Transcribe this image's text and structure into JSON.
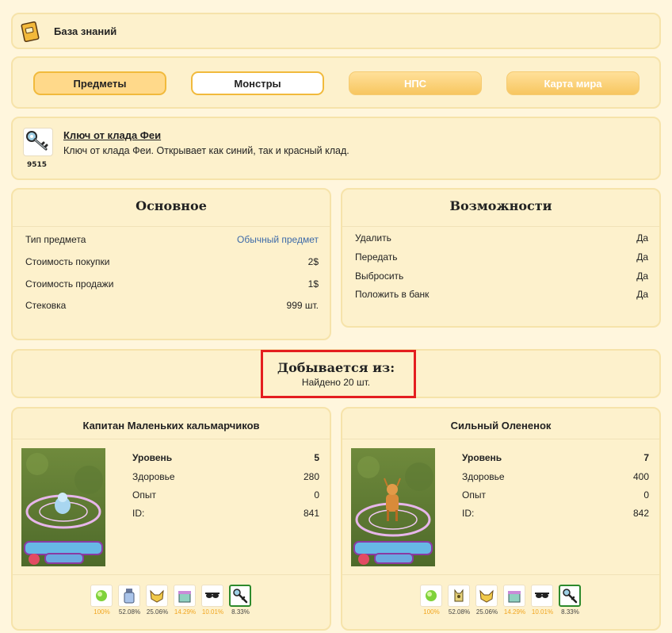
{
  "header": {
    "title": "База знаний",
    "icon": "book-icon"
  },
  "tabs": [
    {
      "label": "Предметы"
    },
    {
      "label": "Монстры"
    },
    {
      "label": "НПС"
    },
    {
      "label": "Карта мира"
    }
  ],
  "item": {
    "icon": "key-icon",
    "id": "9515",
    "name": "Ключ от клада Феи",
    "description": "Ключ от клада Феи. Открывает как синий, так и красный клад."
  },
  "basic": {
    "title": "Основное",
    "rows": [
      {
        "label": "Тип предмета",
        "value": "Обычный предмет"
      },
      {
        "label": "Стоимость покупки",
        "value": "2$"
      },
      {
        "label": "Стоимость продажи",
        "value": "1$"
      },
      {
        "label": "Стековка",
        "value": "999 шт."
      }
    ]
  },
  "capabilities": {
    "title": "Возможности",
    "rows": [
      {
        "label": "Удалить",
        "value": "Да"
      },
      {
        "label": "Передать",
        "value": "Да"
      },
      {
        "label": "Выбросить",
        "value": "Да"
      },
      {
        "label": "Положить в банк",
        "value": "Да"
      }
    ]
  },
  "obtained": {
    "title": "Добывается из:",
    "subtitle": "Найдено 20 шт."
  },
  "monsters": [
    {
      "name": "Капитан Маленьких кальмарчиков",
      "stats": [
        {
          "label": "Уровень",
          "value": "5"
        },
        {
          "label": "Здоровье",
          "value": "280"
        },
        {
          "label": "Опыт",
          "value": "0"
        },
        {
          "label": "ID:",
          "value": "841"
        }
      ],
      "drops": [
        {
          "icon": "green-orb-icon",
          "pct": "100%"
        },
        {
          "icon": "potion-bottle-icon",
          "pct": "52.08%"
        },
        {
          "icon": "pet-mask-icon",
          "pct": "25.06%"
        },
        {
          "icon": "gift-box-icon",
          "pct": "14.29%"
        },
        {
          "icon": "sunglasses-icon",
          "pct": "10.01%"
        },
        {
          "icon": "key-icon",
          "pct": "8.33%"
        }
      ]
    },
    {
      "name": "Сильный Олененок",
      "stats": [
        {
          "label": "Уровень",
          "value": "7"
        },
        {
          "label": "Здоровье",
          "value": "400"
        },
        {
          "label": "Опыт",
          "value": "0"
        },
        {
          "label": "ID:",
          "value": "842"
        }
      ],
      "drops": [
        {
          "icon": "green-orb-icon",
          "pct": "100%"
        },
        {
          "icon": "cat-figure-icon",
          "pct": "52.08%"
        },
        {
          "icon": "pet-mask-icon",
          "pct": "25.06%"
        },
        {
          "icon": "gift-box-icon",
          "pct": "14.29%"
        },
        {
          "icon": "sunglasses-icon",
          "pct": "10.01%"
        },
        {
          "icon": "key-icon",
          "pct": "8.33%"
        }
      ]
    }
  ],
  "colors": {
    "background": "#fff6dd",
    "card": "#fdf1cc",
    "accent": "#f1ba3c",
    "highlight": "#e41e20",
    "link": "#3d6aa8",
    "pct_orange": "#f1a51f",
    "selected": "#2d8a2d"
  }
}
